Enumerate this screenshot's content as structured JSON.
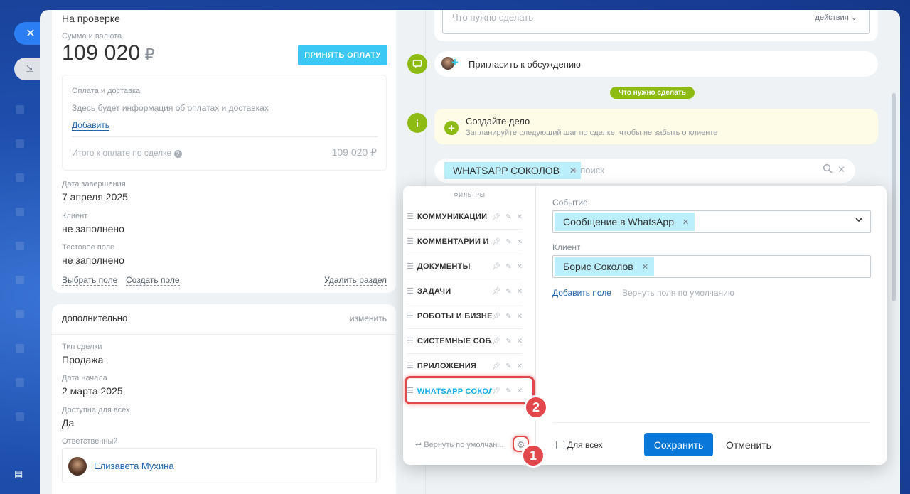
{
  "left_card": {
    "stage": "На проверке",
    "amount_label": "Сумма и валюта",
    "amount": "109 020",
    "currency": "₽",
    "accept_button": "ПРИНЯТЬ ОПЛАТУ",
    "payment_title": "Оплата и доставка",
    "payment_hint": "Здесь будет информация об оплатах и доставках",
    "add_link": "Добавить",
    "total_label": "Итого к оплате по сделке",
    "total_value": "109 020 ₽",
    "end_date_label": "Дата завершения",
    "end_date": "7 апреля 2025",
    "client_label": "Клиент",
    "client_value": "не заполнено",
    "test_label": "Тестовое поле",
    "test_value": "не заполнено",
    "choose_field": "Выбрать поле",
    "create_field": "Создать поле",
    "delete_section": "Удалить раздел"
  },
  "extra_card": {
    "title": "дополнительно",
    "edit": "изменить",
    "type_label": "Тип сделки",
    "type_value": "Продажа",
    "start_label": "Дата начала",
    "start_value": "2 марта 2025",
    "access_label": "Доступна для всех",
    "access_value": "Да",
    "resp_label": "Ответственный",
    "resp_value": "Елизавета Мухина"
  },
  "timeline": {
    "todo_placeholder": "Что нужно сделать",
    "actions": "действия",
    "invite": "Пригласить к обсуждению",
    "todo_pill": "Что нужно сделать",
    "activity_title": "Создайте дело",
    "activity_hint": "Запланируйте следующий шаг по сделке, чтобы не забыть о клиенте",
    "search_tag": "WHATSAPP СОКОЛОВ",
    "search_placeholder": "+ поиск"
  },
  "filters": {
    "title": "ФИЛЬТРЫ",
    "items": [
      {
        "label": "КОММУНИКАЦИИ"
      },
      {
        "label": "КОММЕНТАРИИ И ..."
      },
      {
        "label": "ДОКУМЕНТЫ"
      },
      {
        "label": "ЗАДАЧИ"
      },
      {
        "label": "РОБОТЫ И БИЗНЕС..."
      },
      {
        "label": "СИСТЕМНЫЕ СОБ..."
      },
      {
        "label": "ПРИЛОЖЕНИЯ"
      },
      {
        "label": "WHATSAPP СОКОЛ..."
      }
    ],
    "reset": "Вернуть по умолчан..."
  },
  "form": {
    "event_label": "Событие",
    "event_tag": "Сообщение в WhatsApp",
    "client_label": "Клиент",
    "client_tag": "Борис Соколов",
    "add_field": "Добавить поле",
    "reset_fields": "Вернуть поля по умолчанию",
    "for_all": "Для всех",
    "save": "Сохранить",
    "cancel": "Отменить"
  },
  "badges": {
    "one": "1",
    "two": "2"
  },
  "colors": {
    "accent": "#0877d8",
    "accept": "#3bc8f5",
    "green": "#8dbb14",
    "badge": "#e2474c",
    "tag": "#bceffc"
  }
}
